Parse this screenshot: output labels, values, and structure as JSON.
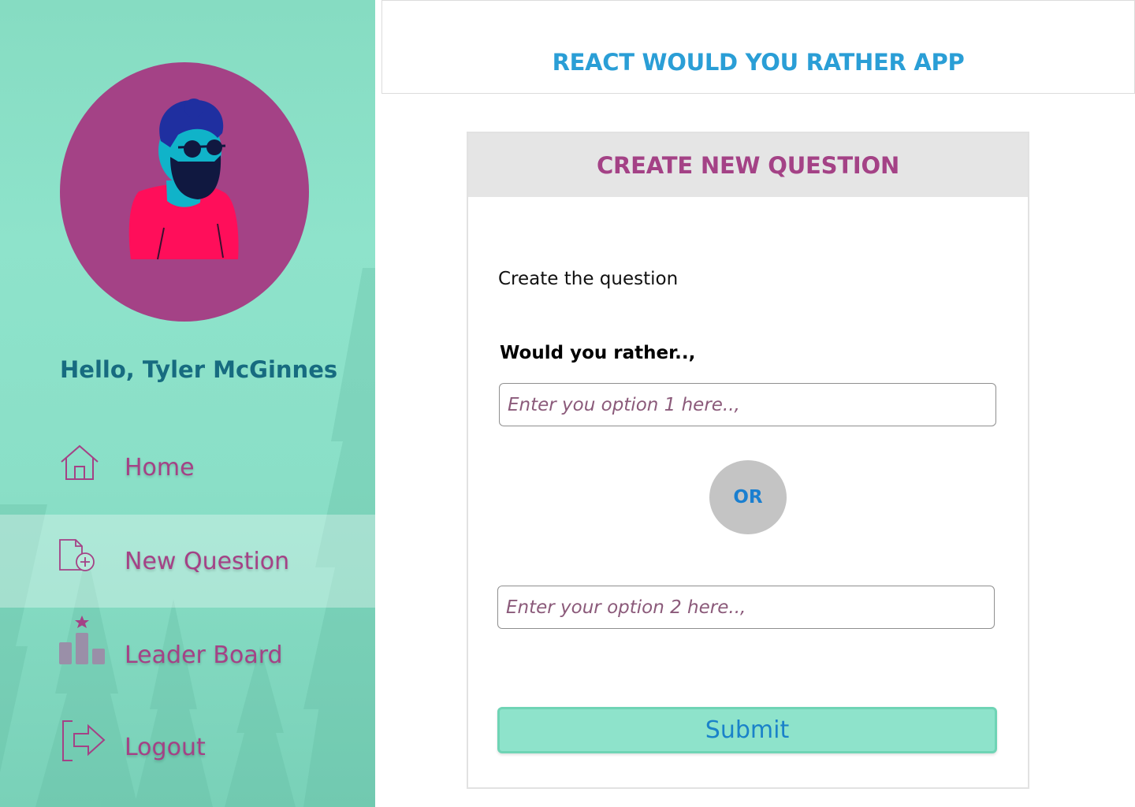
{
  "user": {
    "greeting": "Hello, Tyler McGinnes"
  },
  "nav": {
    "items": [
      {
        "label": "Home",
        "icon": "home-icon",
        "active": false
      },
      {
        "label": "New Question",
        "icon": "new-document-icon",
        "active": true
      },
      {
        "label": "Leader Board",
        "icon": "leaderboard-icon",
        "active": false
      },
      {
        "label": "Logout",
        "icon": "logout-icon",
        "active": false
      }
    ]
  },
  "header": {
    "title": "REACT WOULD YOU RATHER APP"
  },
  "card": {
    "title": "CREATE NEW QUESTION",
    "prompt": "Create the question",
    "subprompt": "Would you rather..,",
    "option1": {
      "value": "",
      "placeholder": "Enter you option 1 here..,"
    },
    "or_label": "OR",
    "option2": {
      "value": "",
      "placeholder": "Enter your option 2 here..,"
    },
    "submit_label": "Submit"
  },
  "colors": {
    "sidebar_bg": "#8ee3cb",
    "accent_purple": "#a44286",
    "accent_blue": "#2a9ed6",
    "greeting_teal": "#176b80",
    "card_header_bg": "#e5e5e5",
    "or_bg": "#c4c4c4",
    "submit_bg": "#8ee3cb"
  }
}
